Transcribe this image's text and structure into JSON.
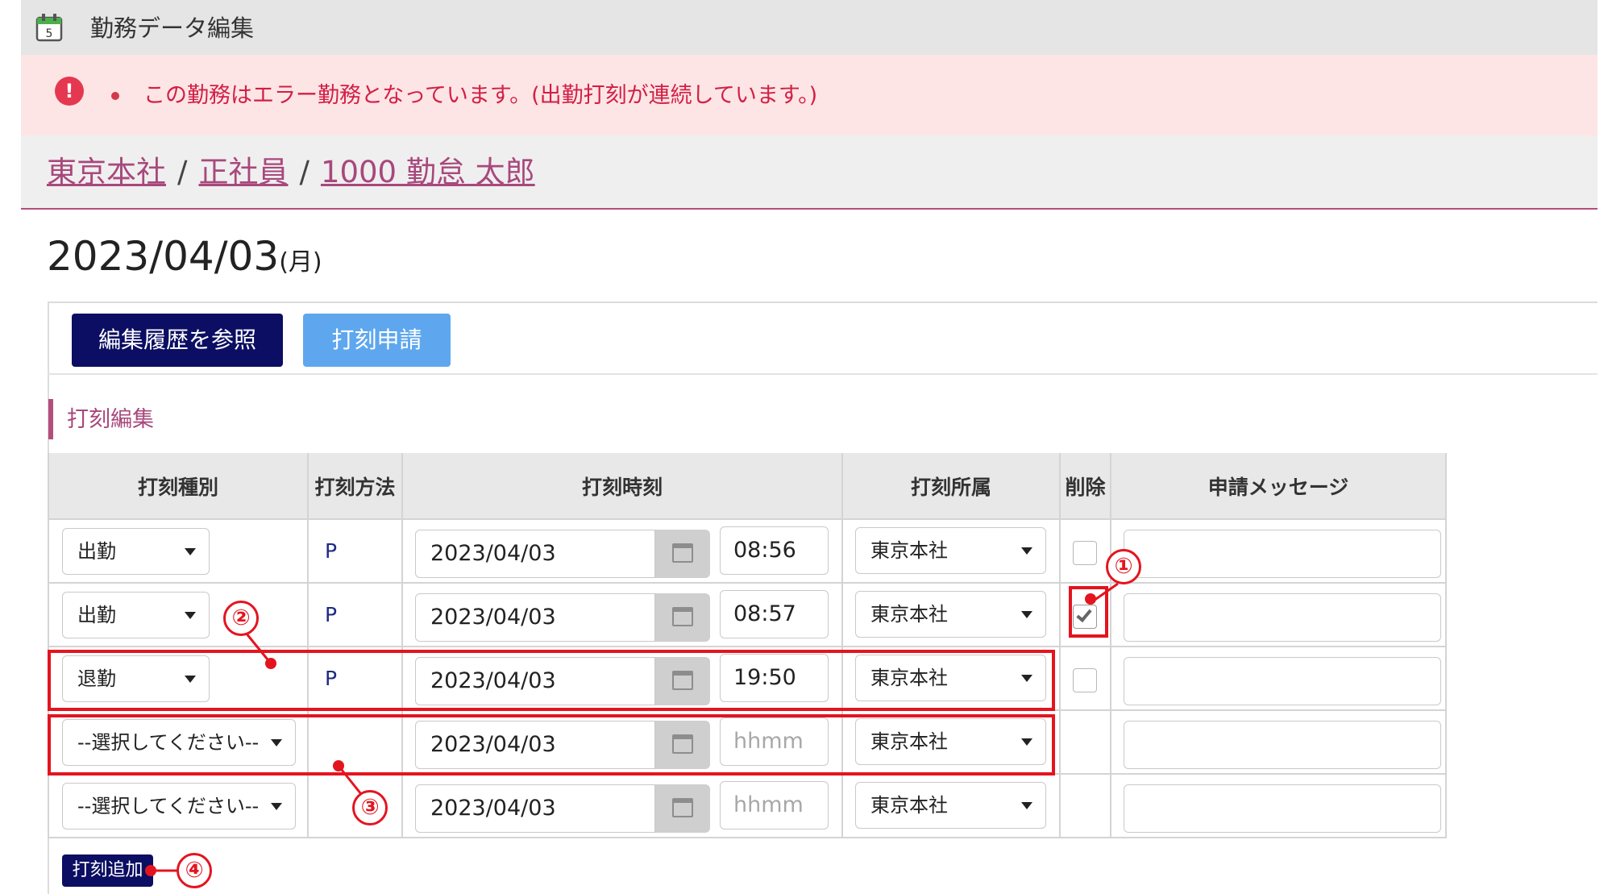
{
  "titlebar": {
    "title": "勤務データ編集",
    "icon": "calendar-icon"
  },
  "error": {
    "text": "この勤務はエラー勤務となっています。(出勤打刻が連続しています。)"
  },
  "breadcrumb": {
    "office": "東京本社",
    "employment": "正社員",
    "employee": "1000 勤怠 太郎",
    "sep": "/"
  },
  "date": {
    "value": "2023/04/03",
    "weekday": "(月)"
  },
  "buttons": {
    "history": "編集履歴を参照",
    "stamp_request": "打刻申請",
    "add_stamp": "打刻追加"
  },
  "section": {
    "title": "打刻編集"
  },
  "table": {
    "headers": {
      "type": "打刻種別",
      "method": "打刻方法",
      "time": "打刻時刻",
      "affiliation": "打刻所属",
      "delete": "削除",
      "message": "申請メッセージ"
    },
    "rows": [
      {
        "type": "出勤",
        "method": "P",
        "date": "2023/04/03",
        "time": "08:56",
        "affiliation": "東京本社",
        "delete": false
      },
      {
        "type": "出勤",
        "method": "P",
        "date": "2023/04/03",
        "time": "08:57",
        "affiliation": "東京本社",
        "delete": true
      },
      {
        "type": "退勤",
        "method": "P",
        "date": "2023/04/03",
        "time": "19:50",
        "affiliation": "東京本社",
        "delete": false
      },
      {
        "type": "--選択してください--",
        "method": "",
        "date": "2023/04/03",
        "time_placeholder": "hhmm",
        "affiliation": "東京本社"
      },
      {
        "type": "--選択してください--",
        "method": "",
        "date": "2023/04/03",
        "time_placeholder": "hhmm",
        "affiliation": "東京本社"
      }
    ]
  },
  "callouts": [
    "①",
    "②",
    "③",
    "④"
  ],
  "colors": {
    "accent": "#a8487c",
    "dark_button": "#0b0e62",
    "light_button": "#5ea7ee",
    "error_bg": "#fde5e5",
    "error_text": "#d21f46",
    "callout": "#e4141f"
  }
}
